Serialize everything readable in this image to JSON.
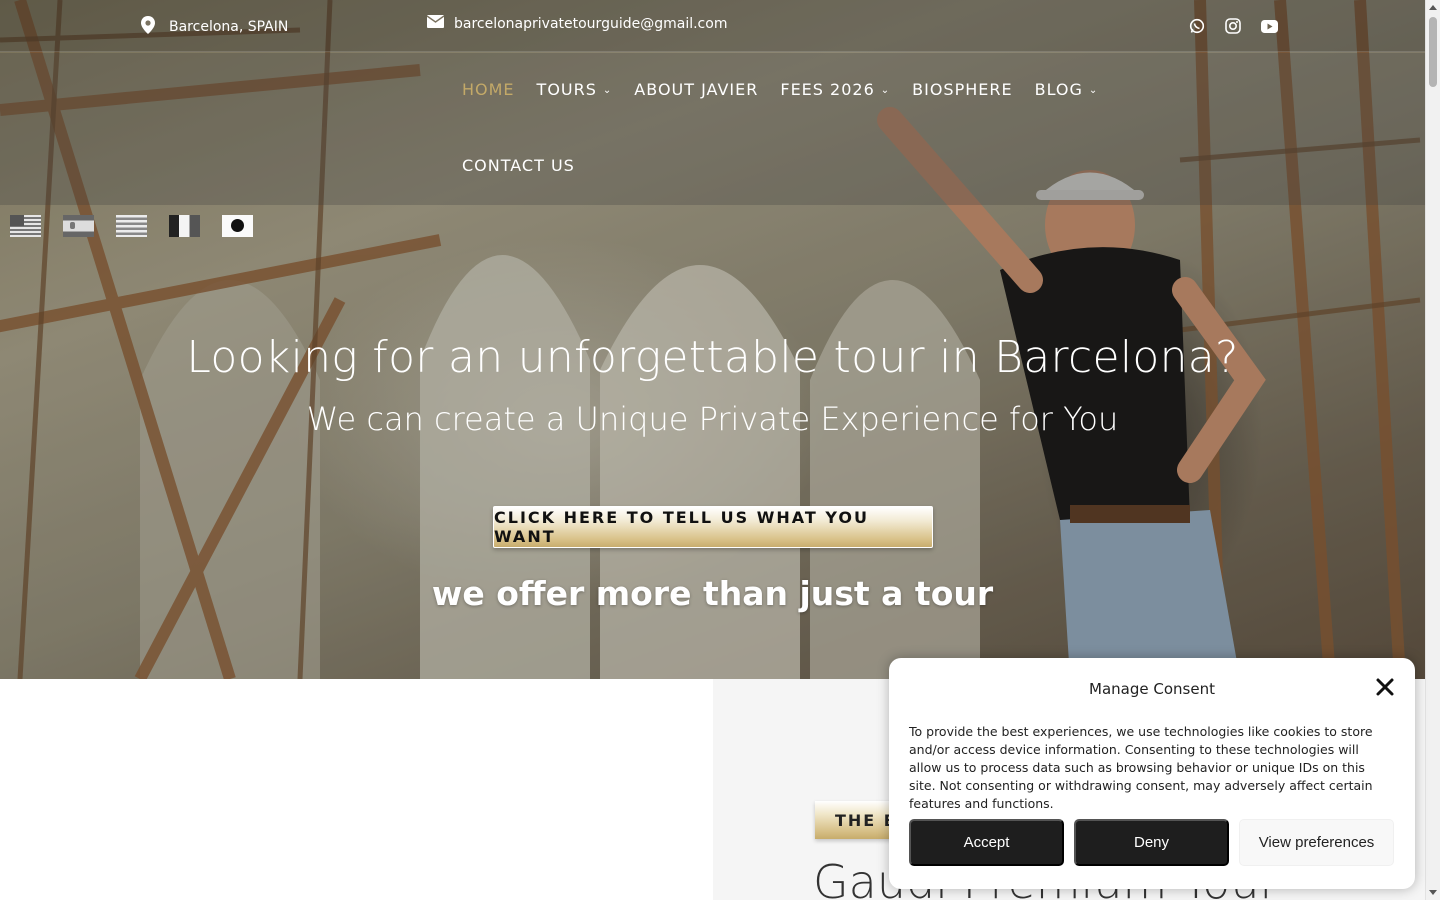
{
  "topbar": {
    "location": "Barcelona, SPAIN",
    "email": "barcelonaprivatetourguide@gmail.com",
    "social_icons": [
      "whatsapp-icon",
      "instagram-icon",
      "youtube-icon"
    ]
  },
  "nav": {
    "items": [
      {
        "label": "HOME",
        "active": true,
        "has_dropdown": false
      },
      {
        "label": "TOURS",
        "active": false,
        "has_dropdown": true
      },
      {
        "label": "ABOUT JAVIER",
        "active": false,
        "has_dropdown": false
      },
      {
        "label": "FEES 2026",
        "active": false,
        "has_dropdown": true
      },
      {
        "label": "BIOSPHERE",
        "active": false,
        "has_dropdown": false
      },
      {
        "label": "BLOG",
        "active": false,
        "has_dropdown": true
      },
      {
        "label": "CONTACT US",
        "active": false,
        "has_dropdown": false
      }
    ],
    "dropdown_glyph": "⌄",
    "active_color": "#c3a968"
  },
  "languages": [
    "english-flag",
    "spanish-flag",
    "greek-flag",
    "french-flag",
    "japanese-flag"
  ],
  "hero": {
    "headline": "Looking for an unforgettable tour in Barcelona?",
    "subheadline": "We can create a Unique Private Experience for You",
    "cta_label": "CLICK HERE TO TELL US WHAT YOU WANT",
    "tagline": "we offer more than just a tour"
  },
  "section": {
    "badge": "THE BEST SELLER",
    "title": "Gaudí Premium Tour"
  },
  "consent": {
    "title": "Manage Consent",
    "body": "To provide the best experiences, we use technologies like cookies to store and/or access device information. Consenting to these technologies will allow us to process data such as browsing behavior or unique IDs on this site. Not consenting or withdrawing consent, may adversely affect certain features and functions.",
    "accept_label": "Accept",
    "deny_label": "Deny",
    "preferences_label": "View preferences"
  },
  "colors": {
    "accent_gold": "#c3a968",
    "button_dark": "#1e1e1e"
  }
}
